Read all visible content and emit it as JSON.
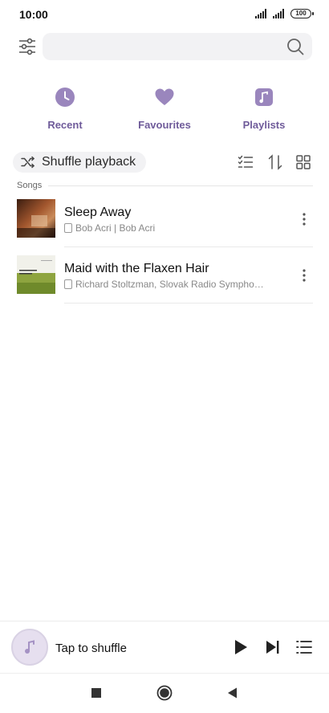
{
  "status_bar": {
    "time": "10:00",
    "battery": "100",
    "icons": [
      "signal-icon",
      "signal-icon",
      "battery-icon"
    ]
  },
  "search": {
    "placeholder": ""
  },
  "categories": [
    {
      "label": "Recent",
      "icon": "clock-icon"
    },
    {
      "label": "Favourites",
      "icon": "heart-icon"
    },
    {
      "label": "Playlists",
      "icon": "playlist-icon"
    }
  ],
  "toolbar": {
    "shuffle_label": "Shuffle playback",
    "icons": [
      "multi-select-icon",
      "sort-icon",
      "grid-view-icon"
    ]
  },
  "section": {
    "label": "Songs"
  },
  "songs": [
    {
      "title": "Sleep Away",
      "subtitle": "Bob Acri | Bob Acri"
    },
    {
      "title": "Maid with the Flaxen Hair",
      "subtitle": "Richard Stoltzman, Slovak Radio Sympho…"
    }
  ],
  "player": {
    "label": "Tap to shuffle"
  },
  "colors": {
    "accent": "#9a86bd",
    "accent_text": "#6f5b9a"
  }
}
